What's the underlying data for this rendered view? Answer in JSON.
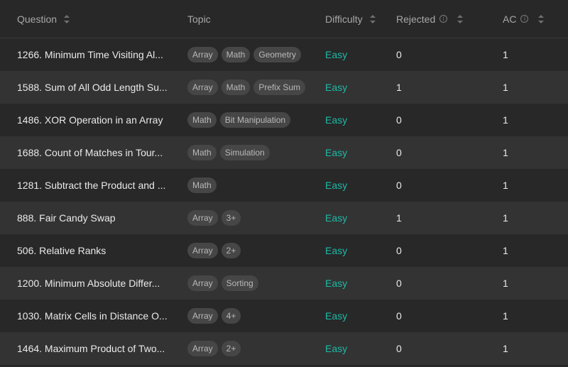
{
  "header": {
    "question": "Question",
    "topic": "Topic",
    "difficulty": "Difficulty",
    "rejected": "Rejected",
    "ac": "AC",
    "info_glyph": "i"
  },
  "colors": {
    "easy": "#1fb8a5",
    "row_dark": "#282828",
    "row_light": "#333333",
    "tag_bg": "#464646"
  },
  "rows": [
    {
      "question": "1266. Minimum Time Visiting Al...",
      "tags": [
        "Array",
        "Math",
        "Geometry"
      ],
      "difficulty": "Easy",
      "rejected": "0",
      "ac": "1"
    },
    {
      "question": "1588. Sum of All Odd Length Su...",
      "tags": [
        "Array",
        "Math",
        "Prefix Sum"
      ],
      "difficulty": "Easy",
      "rejected": "1",
      "ac": "1"
    },
    {
      "question": "1486. XOR Operation in an Array",
      "tags": [
        "Math",
        "Bit Manipulation"
      ],
      "difficulty": "Easy",
      "rejected": "0",
      "ac": "1"
    },
    {
      "question": "1688. Count of Matches in Tour...",
      "tags": [
        "Math",
        "Simulation"
      ],
      "difficulty": "Easy",
      "rejected": "0",
      "ac": "1"
    },
    {
      "question": "1281. Subtract the Product and ...",
      "tags": [
        "Math"
      ],
      "difficulty": "Easy",
      "rejected": "0",
      "ac": "1"
    },
    {
      "question": "888. Fair Candy Swap",
      "tags": [
        "Array",
        "3+"
      ],
      "difficulty": "Easy",
      "rejected": "1",
      "ac": "1"
    },
    {
      "question": "506. Relative Ranks",
      "tags": [
        "Array",
        "2+"
      ],
      "difficulty": "Easy",
      "rejected": "0",
      "ac": "1"
    },
    {
      "question": "1200. Minimum Absolute Differ...",
      "tags": [
        "Array",
        "Sorting"
      ],
      "difficulty": "Easy",
      "rejected": "0",
      "ac": "1"
    },
    {
      "question": "1030. Matrix Cells in Distance O...",
      "tags": [
        "Array",
        "4+"
      ],
      "difficulty": "Easy",
      "rejected": "0",
      "ac": "1"
    },
    {
      "question": "1464. Maximum Product of Two...",
      "tags": [
        "Array",
        "2+"
      ],
      "difficulty": "Easy",
      "rejected": "0",
      "ac": "1"
    }
  ]
}
